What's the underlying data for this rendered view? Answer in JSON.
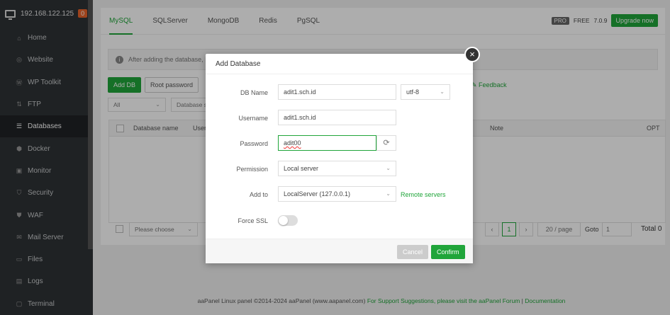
{
  "sidebar": {
    "ip": "192.168.122.125",
    "badge": "0",
    "items": [
      {
        "label": "Home",
        "icon": "home-icon",
        "glyph": "⌂"
      },
      {
        "label": "Website",
        "icon": "globe-icon",
        "glyph": "◎"
      },
      {
        "label": "WP Toolkit",
        "icon": "wordpress-icon",
        "glyph": "Ⓦ"
      },
      {
        "label": "FTP",
        "icon": "ftp-icon",
        "glyph": "⇅"
      },
      {
        "label": "Databases",
        "icon": "database-icon",
        "glyph": "☰"
      },
      {
        "label": "Docker",
        "icon": "docker-icon",
        "glyph": "⬢"
      },
      {
        "label": "Monitor",
        "icon": "monitor-icon",
        "glyph": "▣"
      },
      {
        "label": "Security",
        "icon": "shield-icon",
        "glyph": "⛉"
      },
      {
        "label": "WAF",
        "icon": "waf-icon",
        "glyph": "⛊"
      },
      {
        "label": "Mail Server",
        "icon": "mail-icon",
        "glyph": "✉"
      },
      {
        "label": "Files",
        "icon": "folder-icon",
        "glyph": "▭"
      },
      {
        "label": "Logs",
        "icon": "logs-icon",
        "glyph": "▤"
      },
      {
        "label": "Terminal",
        "icon": "terminal-icon",
        "glyph": "▢"
      }
    ]
  },
  "tabs": [
    "MySQL",
    "SQLServer",
    "MongoDB",
    "Redis",
    "PgSQL"
  ],
  "header": {
    "pro": "PRO",
    "free": "FREE",
    "version": "7.0.9",
    "upgrade": "Upgrade now"
  },
  "notice": "After adding the database, I",
  "toolbar": {
    "add_db": "Add DB",
    "root_password": "Root password",
    "feedback": "Feedback"
  },
  "filter": {
    "all": "All",
    "search": "Database se"
  },
  "table": {
    "col_name": "Database name",
    "col_user": "Usern",
    "col_note": "Note",
    "col_opt": "OPT"
  },
  "bottom": {
    "batch": "Please choose",
    "page": "1",
    "per_page": "20 / page",
    "goto": "Goto",
    "goto_value": "1",
    "total": "Total 0"
  },
  "footer": {
    "text": "aaPanel Linux panel ©2014-2024 aaPanel (www.aapanel.com)",
    "support": "For Support Suggestions, please visit the aaPanel Forum",
    "docs": "Documentation"
  },
  "modal": {
    "title": "Add Database",
    "db_name_label": "DB Name",
    "db_name": "adit1.sch.id",
    "charset": "utf-8",
    "username_label": "Username",
    "username": "adit1.sch.id",
    "password_label": "Password",
    "password": "adit00",
    "permission_label": "Permission",
    "permission": "Local server",
    "addto_label": "Add to",
    "addto": "LocalServer (127.0.0.1)",
    "remote": "Remote servers",
    "forcessl_label": "Force SSL",
    "cancel": "Cancel",
    "confirm": "Confirm"
  },
  "colors": {
    "accent": "#20a53a",
    "sidebar": "#2f3336",
    "badge": "#e8642b"
  }
}
